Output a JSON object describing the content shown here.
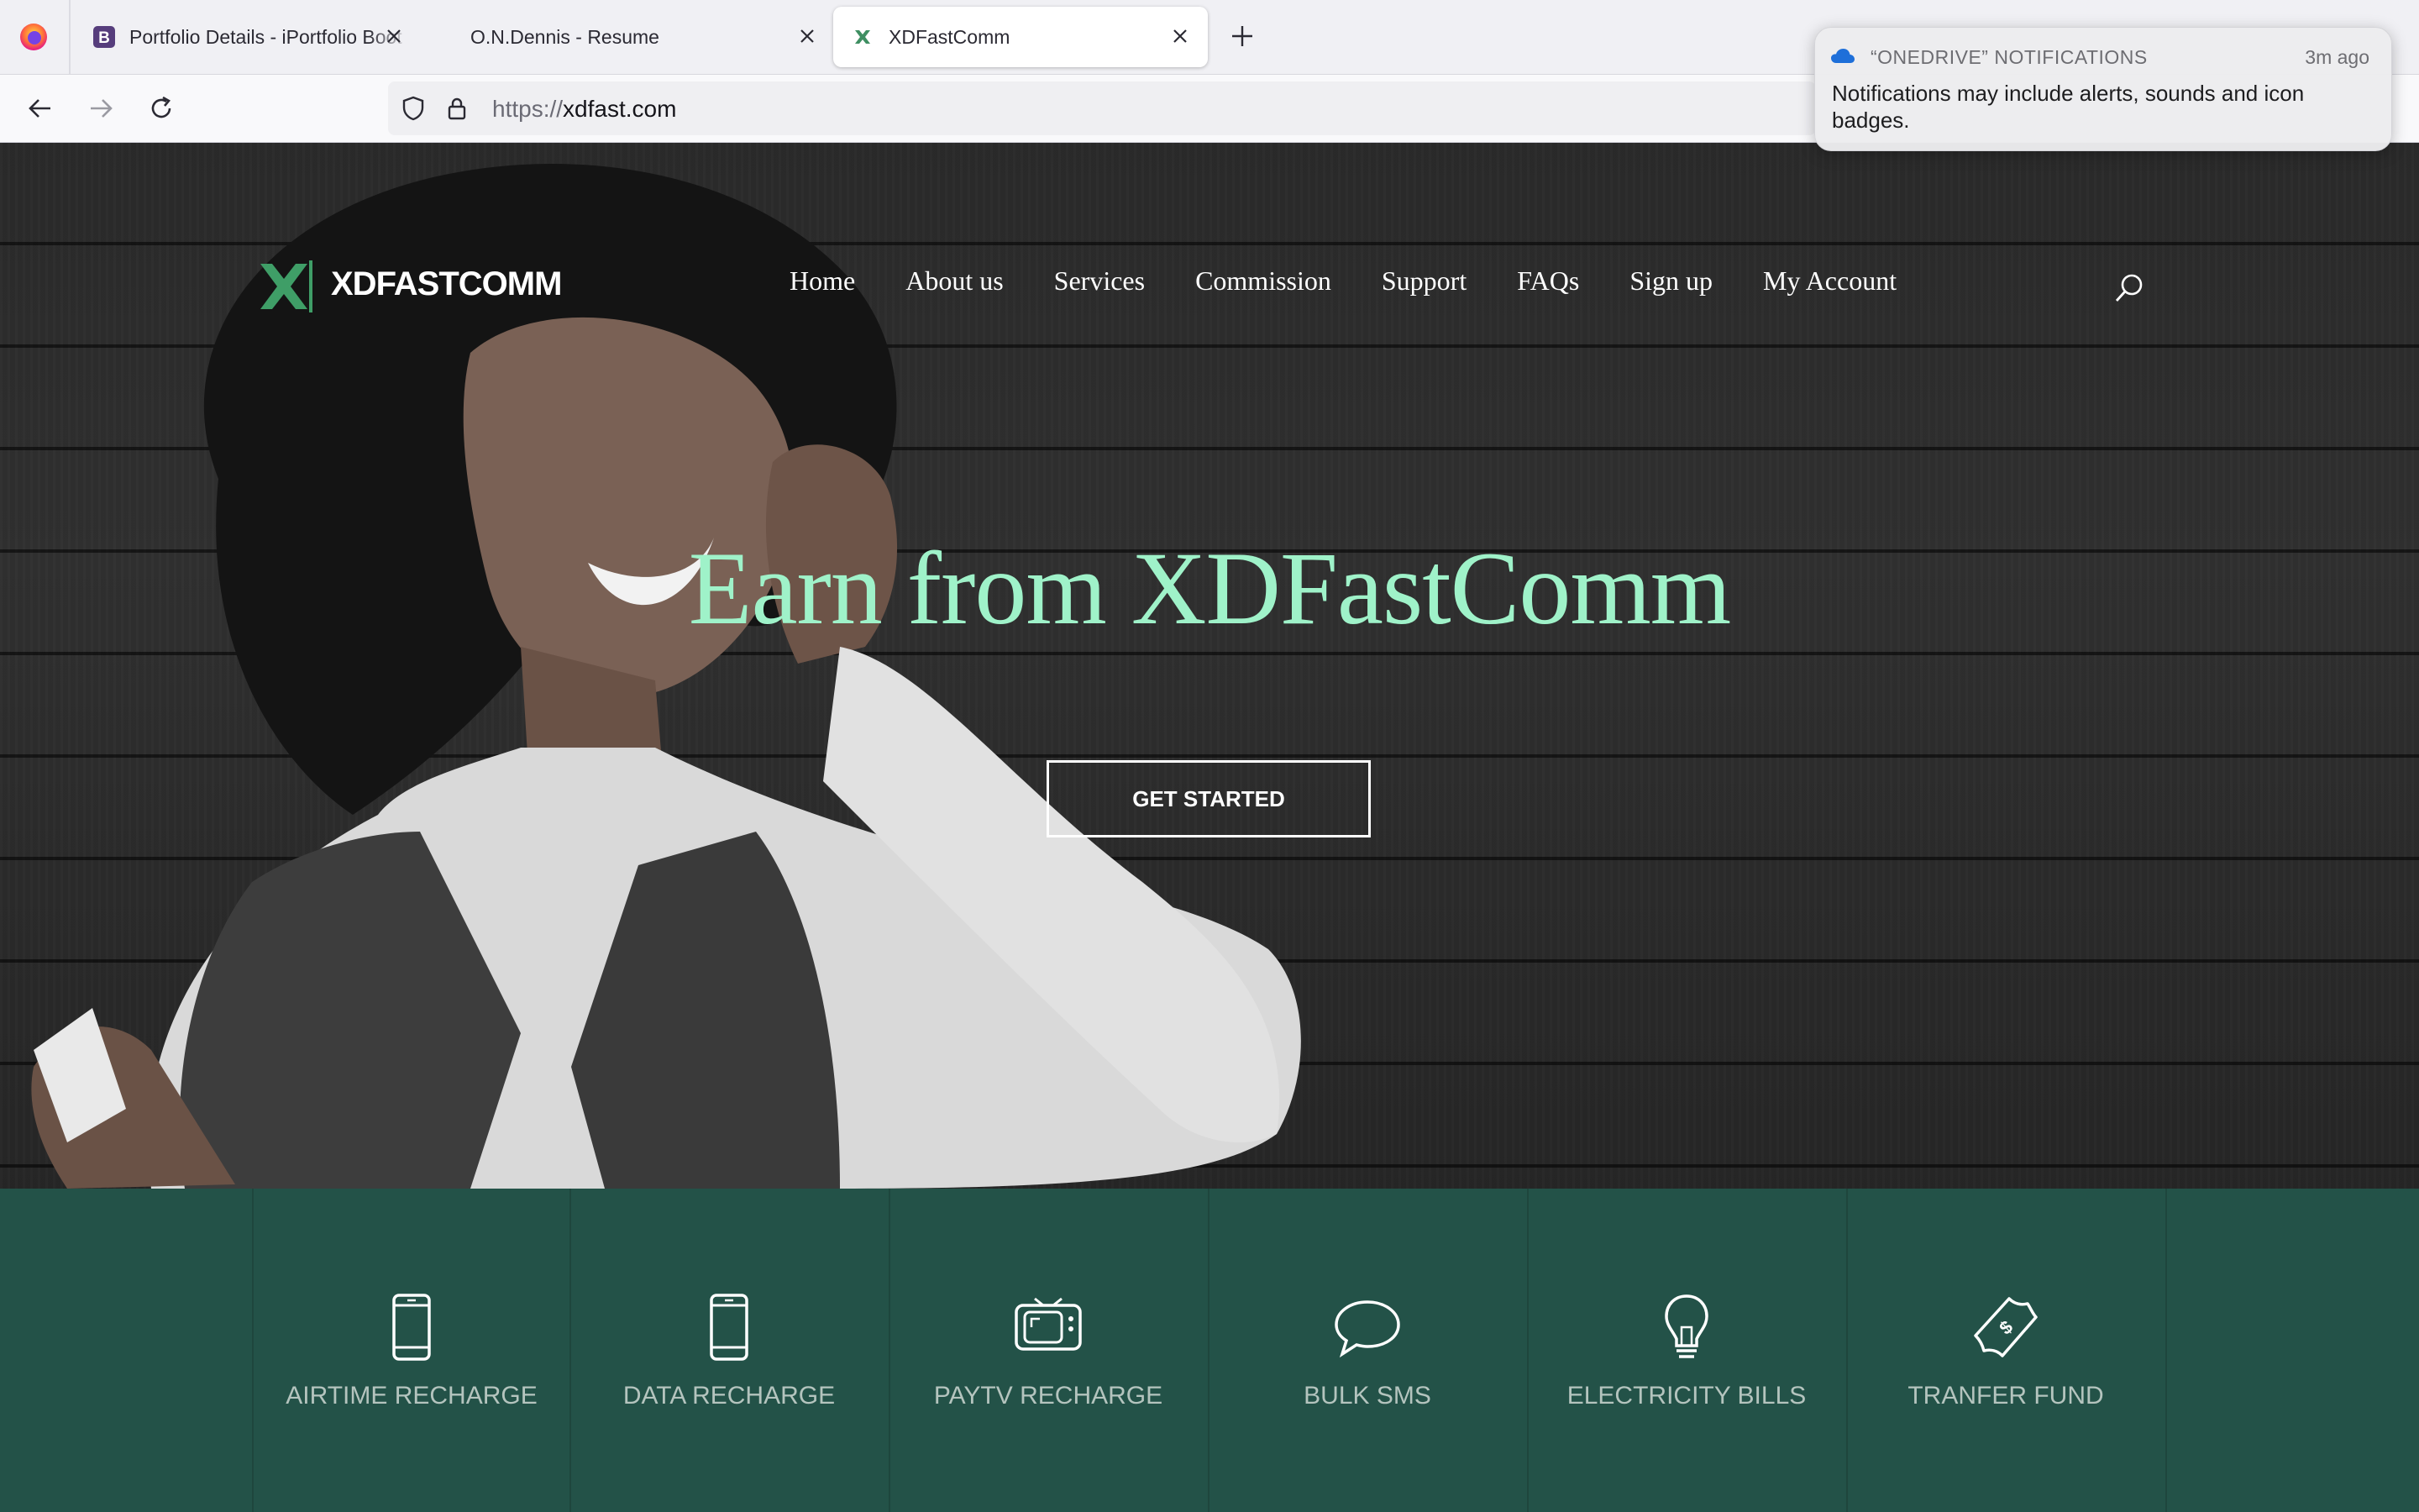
{
  "browser": {
    "tabs": [
      {
        "title": "Portfolio Details - iPortfolio Boot",
        "favicon": "bootstrap-icon",
        "active": false
      },
      {
        "title": "O.N.Dennis - Resume",
        "favicon": "",
        "active": false
      },
      {
        "title": "XDFastComm",
        "favicon": "xdfastcomm-icon",
        "active": true
      }
    ],
    "url": {
      "protocol": "https://",
      "domain": "xdfast.com"
    }
  },
  "notification": {
    "app": "“ONEDRIVE” NOTIFICATIONS",
    "time": "3m ago",
    "body": "Notifications may include alerts, sounds and icon badges."
  },
  "site": {
    "logo_text": "XDFASTCOMM",
    "nav": [
      "Home",
      "About us",
      "Services",
      "Commission",
      "Support",
      "FAQs",
      "Sign up",
      "My Account"
    ],
    "hero_title": "Earn from XDFastComm",
    "cta_label": "GET STARTED",
    "accent_color": "#9ff2c9",
    "services_bg": "#235248",
    "services": [
      {
        "label": "AIRTIME RECHARGE",
        "icon": "mobile-phone-icon"
      },
      {
        "label": "DATA RECHARGE",
        "icon": "tablet-icon"
      },
      {
        "label": "PAYTV RECHARGE",
        "icon": "tv-icon"
      },
      {
        "label": "BULK SMS",
        "icon": "chat-bubble-icon"
      },
      {
        "label": "ELECTRICITY BILLS",
        "icon": "lightbulb-icon"
      },
      {
        "label": "TRANFER FUND",
        "icon": "money-icon"
      }
    ]
  }
}
